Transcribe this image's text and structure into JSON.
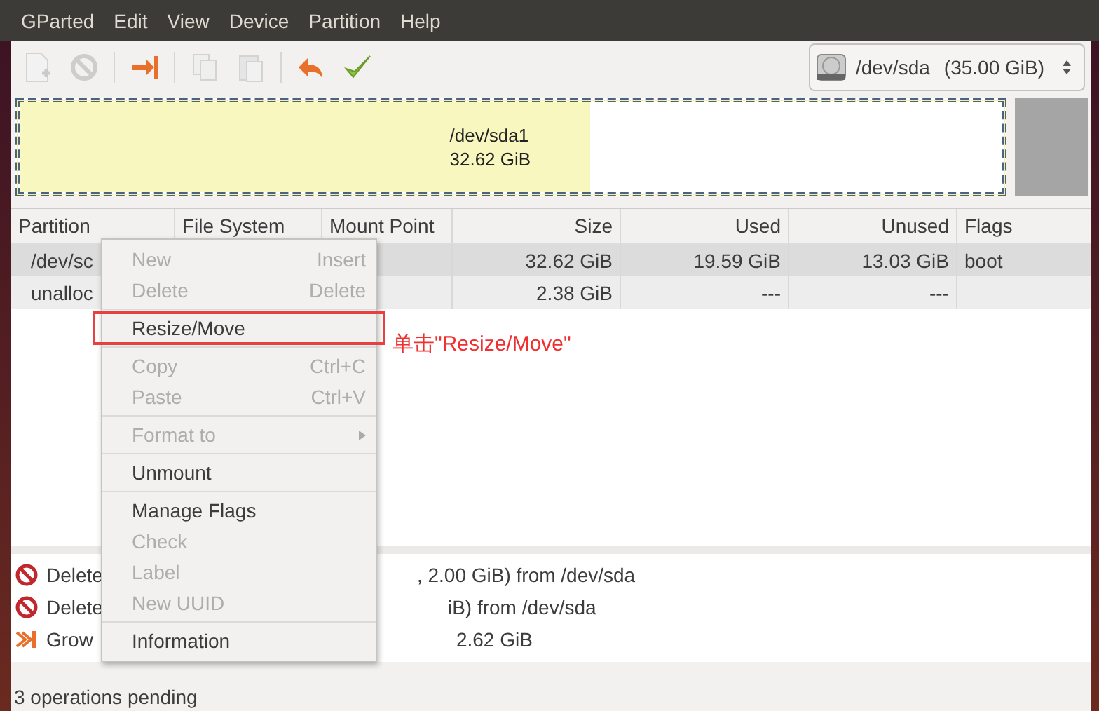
{
  "menu_bar": [
    "GParted",
    "Edit",
    "View",
    "Device",
    "Partition",
    "Help"
  ],
  "toolbar": [
    {
      "kind": "new",
      "disabled": true
    },
    {
      "kind": "delete",
      "disabled": true
    },
    {
      "kind": "sep"
    },
    {
      "kind": "resize",
      "disabled": false
    },
    {
      "kind": "sep"
    },
    {
      "kind": "copy",
      "disabled": true
    },
    {
      "kind": "paste",
      "disabled": true
    },
    {
      "kind": "sep"
    },
    {
      "kind": "undo",
      "disabled": false
    },
    {
      "kind": "apply",
      "disabled": false
    }
  ],
  "device": {
    "name": "/dev/sda",
    "size": "(35.00 GiB)"
  },
  "disk_map": {
    "name": "/dev/sda1",
    "size": "32.62 GiB",
    "level": 0.58
  },
  "table": {
    "columns": [
      "Partition",
      "File System",
      "Mount Point",
      "Size",
      "Used",
      "Unused",
      "Flags"
    ],
    "rows": [
      {
        "selected": true,
        "cells": [
          "/dev/sc",
          "",
          "",
          "32.62 GiB",
          "19.59 GiB",
          "13.03 GiB",
          "boot"
        ]
      },
      {
        "selected": false,
        "cells": [
          "unalloc",
          "",
          "",
          "2.38 GiB",
          "---",
          "---",
          ""
        ]
      }
    ]
  },
  "context_menu": [
    {
      "kind": "item",
      "label": "New",
      "shortcut": "Insert",
      "disabled": true
    },
    {
      "kind": "item",
      "label": "Delete",
      "shortcut": "Delete",
      "disabled": true
    },
    {
      "kind": "separator"
    },
    {
      "kind": "item",
      "label": "Resize/Move",
      "disabled": false,
      "highlighted": true
    },
    {
      "kind": "separator"
    },
    {
      "kind": "item",
      "label": "Copy",
      "shortcut": "Ctrl+C",
      "disabled": true
    },
    {
      "kind": "item",
      "label": "Paste",
      "shortcut": "Ctrl+V",
      "disabled": true
    },
    {
      "kind": "separator"
    },
    {
      "kind": "submenu",
      "label": "Format to",
      "disabled": true
    },
    {
      "kind": "separator"
    },
    {
      "kind": "item",
      "label": "Unmount",
      "disabled": false
    },
    {
      "kind": "separator"
    },
    {
      "kind": "item",
      "label": "Manage Flags",
      "disabled": false
    },
    {
      "kind": "item",
      "label": "Check",
      "disabled": true
    },
    {
      "kind": "item",
      "label": "Label",
      "disabled": true
    },
    {
      "kind": "item",
      "label": "New UUID",
      "disabled": true
    },
    {
      "kind": "separator"
    },
    {
      "kind": "item",
      "label": "Information",
      "disabled": false
    }
  ],
  "annotation": "单击\"Resize/Move\"",
  "operations": [
    {
      "kind": "delete",
      "text": "Delete",
      "detail": ", 2.00 GiB) from /dev/sda"
    },
    {
      "kind": "delete",
      "text": "Delete",
      "detail": "iB) from /dev/sda"
    },
    {
      "kind": "grow",
      "text": "Grow",
      "detail": "2.62 GiB"
    }
  ],
  "status_bar": "3 operations pending"
}
